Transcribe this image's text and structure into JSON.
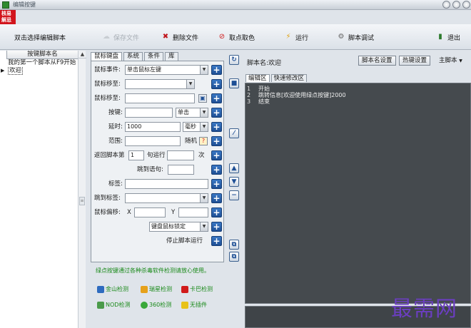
{
  "window": {
    "title": "编辑按键",
    "logo_text": "核易\n解忌"
  },
  "toolbar": {
    "hint": "双击选择编辑脚本",
    "save": "保存文件",
    "delete": "删除文件",
    "pick_color": "取点取色",
    "run": "运行",
    "debug": "脚本调试",
    "exit": "退出"
  },
  "script_list": {
    "header": "按键脚本名",
    "items": [
      "我的第一个脚本从F9开始",
      "欢迎"
    ],
    "selected_index": 1
  },
  "command_tabs": [
    "鼠标键盘",
    "系统",
    "条件",
    "库"
  ],
  "form": {
    "mouse_event_label": "鼠标事件:",
    "mouse_event_value": "单击鼠标左键",
    "move_to_label_1": "鼠标移至:",
    "move_to_label_2": "鼠标移至:",
    "key_label": "按键:",
    "key_action_value": "单击",
    "delay_label": "延时:",
    "delay_value": "1000",
    "delay_unit": "毫秒",
    "range_label": "范围:",
    "random_label": "随机",
    "return_label": "返回脚本第",
    "return_value": "1",
    "return_suffix": "句运行",
    "times_label": "次",
    "jump_to_label": "跳到语句:",
    "tag_label": "标签:",
    "jump_tag_label": "跳到标签:",
    "offset_label": "鼠标偏移:",
    "offset_x_label": "X",
    "offset_y_label": "Y",
    "lock_value": "键盘鼠标锁定",
    "stop_label": "停止脚本运行"
  },
  "notice": "绿点按键通过各种杀毒软件检测请放心使用。",
  "detections": [
    "金山检测",
    "瑞星检测",
    "卡巴检测",
    "NOD检测",
    "360检测",
    "无插件"
  ],
  "editor": {
    "script_name_label": "脚本名:欢迎",
    "name_setting_button": "脚本名设置",
    "hotkey_button": "热键设置",
    "main_script": "主脚本",
    "tabs": [
      "编辑区",
      "快速修改区"
    ],
    "lines": [
      {
        "num": "1",
        "text": "开始"
      },
      {
        "num": "2",
        "text": "跳转信息[欢迎使用绿点按键]2000"
      },
      {
        "num": "3",
        "text": "结束"
      }
    ]
  },
  "watermark": "最需网",
  "colors": {
    "accent_blue": "#1e4f95",
    "code_bg": "#454a4e",
    "notice_green": "#1a8a1a",
    "logo_red": "#d2151d"
  }
}
